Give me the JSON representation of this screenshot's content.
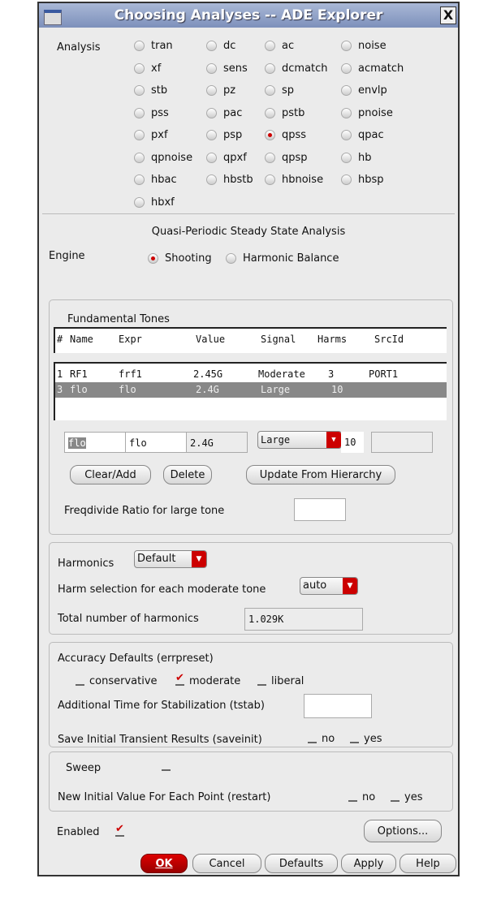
{
  "window": {
    "title": "Choosing Analyses -- ADE Explorer",
    "close": "X"
  },
  "analysis": {
    "label": "Analysis",
    "selected": "qpss",
    "options": [
      "tran",
      "dc",
      "ac",
      "noise",
      "xf",
      "sens",
      "dcmatch",
      "acmatch",
      "stb",
      "pz",
      "sp",
      "envlp",
      "pss",
      "pac",
      "pstb",
      "pnoise",
      "pxf",
      "psp",
      "qpss",
      "qpac",
      "qpnoise",
      "qpxf",
      "qpsp",
      "hb",
      "hbac",
      "hbstb",
      "hbnoise",
      "hbsp",
      "hbxf"
    ]
  },
  "section_title": "Quasi-Periodic Steady State Analysis",
  "engine": {
    "label": "Engine",
    "options": [
      "Shooting",
      "Harmonic Balance"
    ],
    "selected": "Shooting"
  },
  "tones": {
    "title": "Fundamental Tones",
    "columns": [
      "#",
      "Name",
      "Expr",
      "Value",
      "Signal",
      "Harms",
      "SrcId"
    ],
    "rows": [
      [
        "1",
        "RF1",
        "frf1",
        "2.45G",
        "Moderate",
        "3",
        "PORT1"
      ],
      [
        "3",
        "flo",
        "flo",
        "2.4G",
        "Large",
        "10",
        ""
      ]
    ],
    "selected_row": 1,
    "edit": {
      "name": "flo",
      "expr": "flo",
      "value": "2.4G",
      "signal": "Large",
      "harms": "10",
      "srcid": ""
    },
    "clear_add": "Clear/Add",
    "delete": "Delete",
    "update": "Update From Hierarchy",
    "freqdivide_label": "Freqdivide Ratio for large tone",
    "freqdivide_value": ""
  },
  "harmonics": {
    "label": "Harmonics",
    "value": "Default",
    "harm_sel_label": "Harm selection for each moderate tone",
    "harm_sel_value": "auto",
    "total_label": "Total number of harmonics",
    "total_value": "1.029K"
  },
  "accuracy": {
    "label": "Accuracy Defaults (errpreset)",
    "options": [
      {
        "label": "conservative",
        "checked": false
      },
      {
        "label": "moderate",
        "checked": true
      },
      {
        "label": "liberal",
        "checked": false
      }
    ],
    "tstab_label": "Additional Time for Stabilization (tstab)",
    "tstab_value": "",
    "saveinit_label": "Save Initial Transient Results (saveinit)",
    "no": "no",
    "yes": "yes"
  },
  "sweep": {
    "label": "Sweep",
    "restart_label": "New Initial Value For Each Point (restart)",
    "no": "no",
    "yes": "yes"
  },
  "enabled_label": "Enabled",
  "buttons": {
    "options": "Options...",
    "ok": "OK",
    "cancel": "Cancel",
    "defaults": "Defaults",
    "apply": "Apply",
    "help": "Help"
  }
}
